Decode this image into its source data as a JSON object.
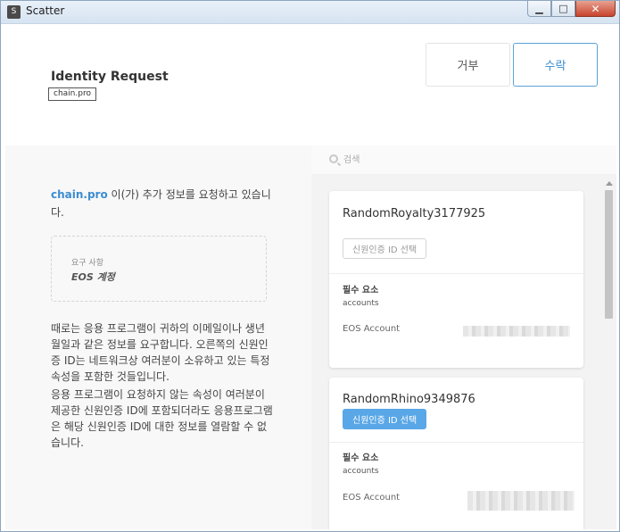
{
  "window": {
    "title": "Scatter",
    "icon_letter": "S",
    "minimize_icon": "minimize-icon",
    "maximize_icon": "maximize-icon",
    "close_icon": "close-icon"
  },
  "header": {
    "title": "Identity Request",
    "domain": "chain.pro",
    "deny_label": "거부",
    "accept_label": "수락"
  },
  "left": {
    "intro_domain": "chain.pro",
    "intro_text": " 이(가) 추가 정보를 요청하고 있습니다.",
    "requirements_label": "요구 사항",
    "requirements_value": "EOS 계정",
    "desc_1": "때로는 응용 프로그램이 귀하의 이메일이나 생년월일과 같은 정보를 요구합니다. 오른쪽의 신원인증 ID는 네트워크상 여러분이 소유하고 있는 특정 속성을 포함한 것들입니다.",
    "desc_2": "응용 프로그램이 요청하지 않는 속성이 여러분이 제공한 신원인증 ID에 포함되더라도 응용프로그램은 해당 신원인증 ID에 대한 정보를 열람할 수 없습니다."
  },
  "search": {
    "placeholder": "검색",
    "icon": "search-icon"
  },
  "identities": [
    {
      "name": "RandomRoyalty3177925",
      "select_label": "신원인증 ID 선택",
      "selected": false,
      "required_header": "필수 요소",
      "required_item": "accounts",
      "account_label": "EOS Account"
    },
    {
      "name": "RandomRhino9349876",
      "select_label": "신원인증 ID 선택",
      "selected": true,
      "required_header": "필수 요소",
      "required_item": "accounts",
      "account_label": "EOS Account"
    }
  ],
  "colors": {
    "accent": "#3b8cd1",
    "selected_button": "#59a7e6"
  }
}
